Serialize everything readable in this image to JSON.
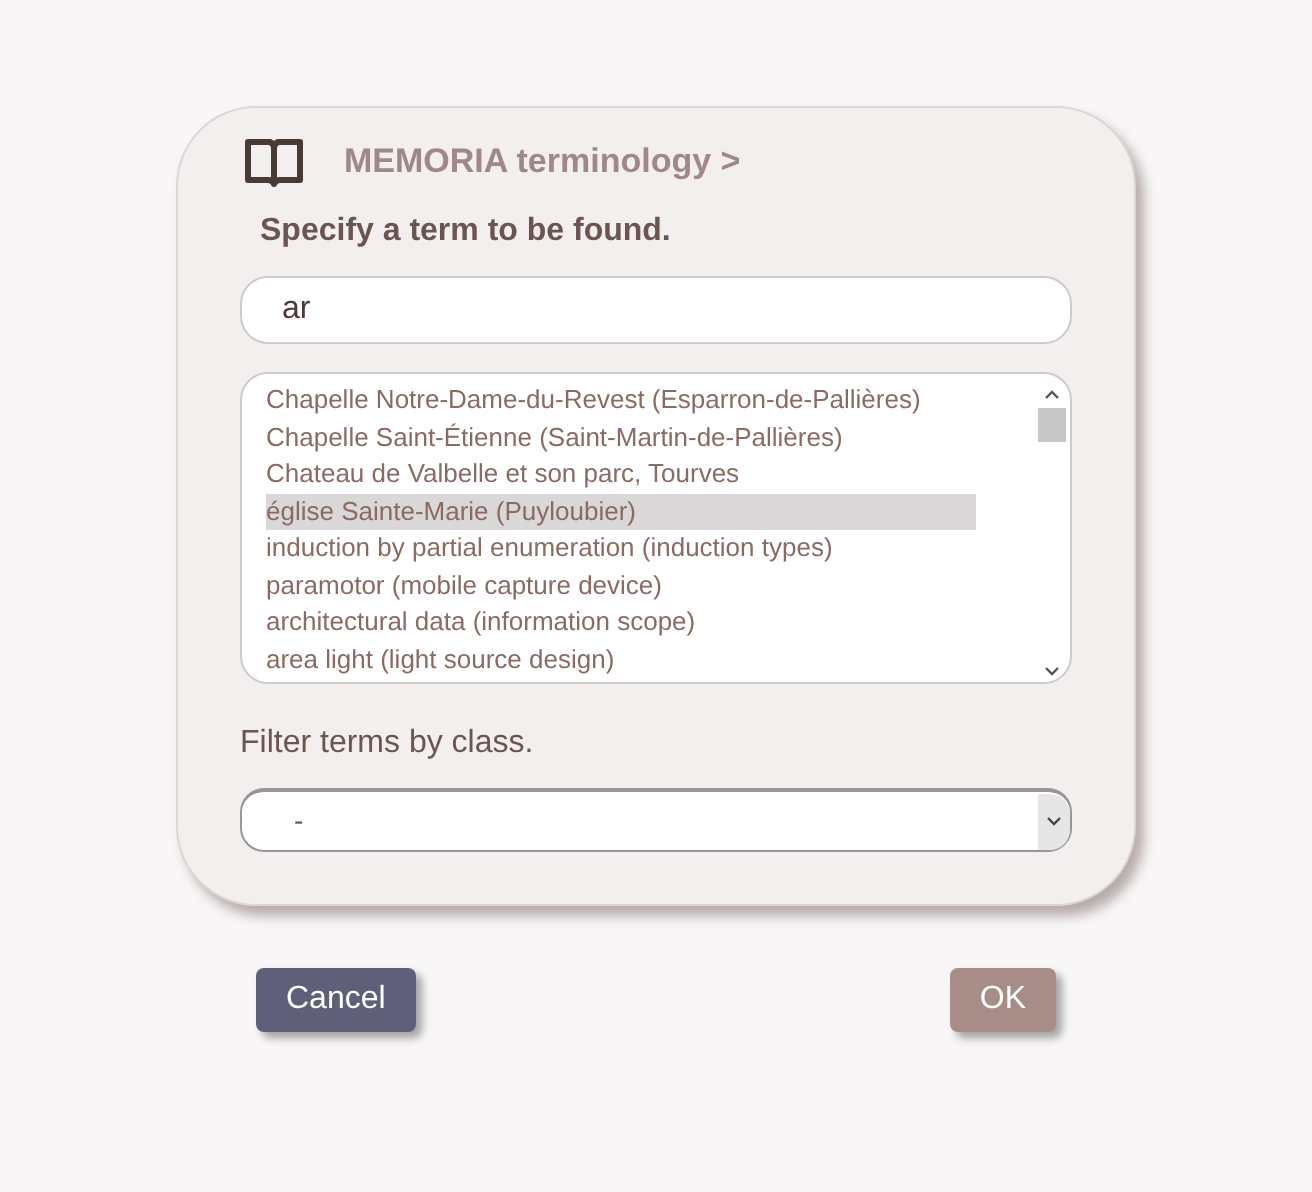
{
  "dialog": {
    "title": "MEMORIA terminology >",
    "prompt": "Specify a term to be found.",
    "search": {
      "value": "ar"
    },
    "results": [
      {
        "label": "Chapelle Notre-Dame-du-Revest (Esparron-de-Pallières)",
        "selected": false
      },
      {
        "label": "Chapelle Saint-Étienne (Saint-Martin-de-Pallières)",
        "selected": false
      },
      {
        "label": "Chateau de Valbelle et son parc, Tourves",
        "selected": false
      },
      {
        "label": "église Sainte-Marie (Puyloubier)",
        "selected": true
      },
      {
        "label": "induction by partial enumeration (induction types)",
        "selected": false
      },
      {
        "label": "paramotor (mobile capture device)",
        "selected": false
      },
      {
        "label": "architectural data (information scope)",
        "selected": false
      },
      {
        "label": "area light (light source design)",
        "selected": false
      }
    ],
    "filter_label": "Filter terms by class.",
    "filter": {
      "value": "-"
    }
  },
  "buttons": [
    {
      "label": "Cancel",
      "kind": "cancel"
    },
    {
      "label": "OK",
      "kind": "ok"
    }
  ]
}
